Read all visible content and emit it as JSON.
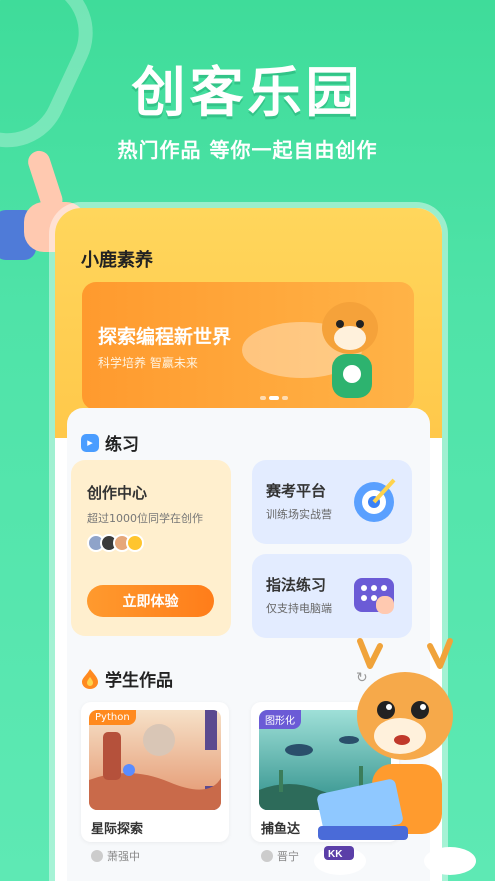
{
  "hero": {
    "title": "创客乐园",
    "subtitle": "热门作品 等你一起自由创作"
  },
  "app": {
    "name": "小鹿素养",
    "banner": {
      "title": "探索编程新世界",
      "subtitle": "科学培养 智赢未来"
    }
  },
  "practice": {
    "section_title": "练习",
    "create_center": {
      "title": "创作中心",
      "subtitle": "超过1000位同学在创作",
      "button": "立即体验"
    },
    "exam": {
      "title": "赛考平台",
      "subtitle": "训练场实战营"
    },
    "finger": {
      "title": "指法练习",
      "subtitle": "仅支持电脑端"
    }
  },
  "works": {
    "section_title": "学生作品",
    "items": [
      {
        "tag": "Python",
        "title": "星际探索",
        "author": "萧强中"
      },
      {
        "tag": "图形化",
        "title": "捕鱼达",
        "author": "晋宁"
      }
    ]
  },
  "colors": {
    "bg": "#4fe3a8",
    "accent": "#ff9a2e",
    "banner_yellow": "#ffc84a",
    "card_blue": "#e3ecff",
    "card_cream": "#ffefce"
  }
}
